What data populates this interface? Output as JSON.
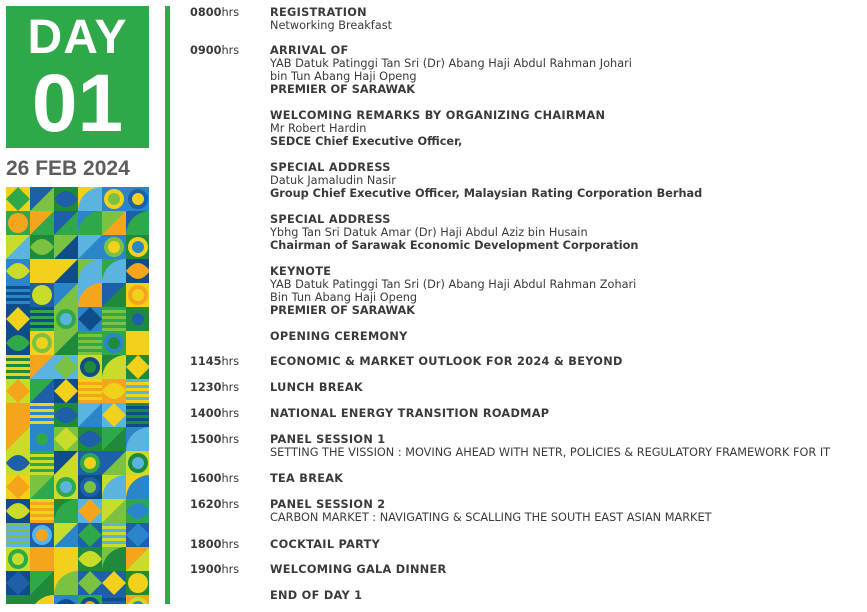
{
  "day_badge": {
    "word": "DAY",
    "number": "01",
    "date": "26 FEB 2024",
    "brand_color": "#2fa84a"
  },
  "schedule": [
    {
      "time_num": "0800",
      "time_unit": "hrs",
      "heading": "REGISTRATION",
      "lines": [
        "Networking Breakfast"
      ]
    },
    {
      "time_num": "0900",
      "time_unit": "hrs",
      "heading": "ARRIVAL OF",
      "lines": [
        "YAB Datuk Patinggi Tan Sri (Dr) Abang Haji Abdul Rahman Johari",
        "bin Tun Abang Haji Openg"
      ],
      "bold_line": "PREMIER OF SARAWAK"
    },
    {
      "heading": "WELCOMING REMARKS BY ORGANIZING CHAIRMAN",
      "lines": [
        "Mr Robert Hardin"
      ],
      "bold_line": "SEDCE Chief Executive Officer,"
    },
    {
      "heading": "SPECIAL ADDRESS",
      "lines": [
        "Datuk Jamaludin Nasir"
      ],
      "bold_line": "Group Chief Executive Officer, Malaysian Rating Corporation Berhad"
    },
    {
      "heading": "SPECIAL ADDRESS",
      "lines": [
        "Ybhg Tan Sri Datuk Amar (Dr) Haji Abdul Aziz bin Husain"
      ],
      "bold_line": "Chairman of Sarawak Economic Development Corporation"
    },
    {
      "heading": "KEYNOTE",
      "lines": [
        "YAB Datuk Patinggi Tan Sri (Dr) Abang Haji Abdul Rahman Zohari",
        "Bin Tun Abang Haji Openg"
      ],
      "bold_line": "PREMIER OF SARAWAK"
    },
    {
      "heading": "OPENING CEREMONY"
    },
    {
      "time_num": "1145",
      "time_unit": "hrs",
      "heading": "ECONOMIC & MARKET OUTLOOK FOR 2024 & BEYOND"
    },
    {
      "time_num": "1230",
      "time_unit": "hrs",
      "heading": "LUNCH BREAK"
    },
    {
      "time_num": "1400",
      "time_unit": "hrs",
      "heading": "NATIONAL ENERGY TRANSITION ROADMAP"
    },
    {
      "time_num": "1500",
      "time_unit": "hrs",
      "heading": "PANEL SESSION 1",
      "lines": [
        "SETTING THE VISSION : MOVING AHEAD WITH NETR, POLICIES & REGULATORY FRAMEWORK FOR IT"
      ]
    },
    {
      "time_num": "1600",
      "time_unit": "hrs",
      "heading": "TEA BREAK"
    },
    {
      "time_num": "1620",
      "time_unit": "hrs",
      "heading": "PANEL SESSION 2",
      "lines": [
        "CARBON MARKET : NAVIGATING & SCALLING THE SOUTH EAST ASIAN MARKET"
      ]
    },
    {
      "time_num": "1800",
      "time_unit": "hrs",
      "heading": "COCKTAIL PARTY"
    },
    {
      "time_num": "1900",
      "time_unit": "hrs",
      "heading": "WELCOMING GALA DINNER"
    },
    {
      "heading": "END OF DAY 1"
    }
  ]
}
